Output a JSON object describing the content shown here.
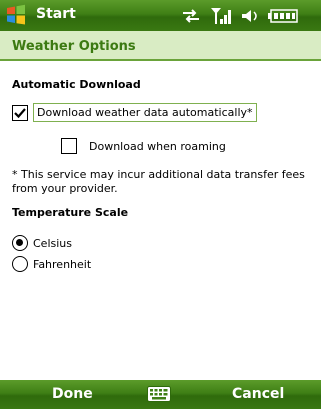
{
  "titlebar": {
    "title": "Start",
    "icons": [
      "windows-logo-icon",
      "sync-arrows-icon",
      "signal-icon",
      "volume-icon",
      "battery-icon"
    ]
  },
  "page": {
    "title": "Weather Options"
  },
  "download": {
    "heading": "Automatic Download",
    "auto_label": "Download weather data automatically*",
    "auto_checked": true,
    "roaming_label": "Download when roaming",
    "roaming_checked": false,
    "note": "* This service may incur additional data transfer fees from your provider."
  },
  "temperature": {
    "heading": "Temperature Scale",
    "options": [
      {
        "label": "Celsius",
        "selected": true
      },
      {
        "label": "Fahrenheit",
        "selected": false
      }
    ]
  },
  "softkeys": {
    "left": "Done",
    "right": "Cancel",
    "middle_icon": "keyboard-icon"
  },
  "colors": {
    "bar_green": "#3f7f15",
    "header_bg": "#d9ecc4",
    "title_green": "#3c7a12"
  }
}
